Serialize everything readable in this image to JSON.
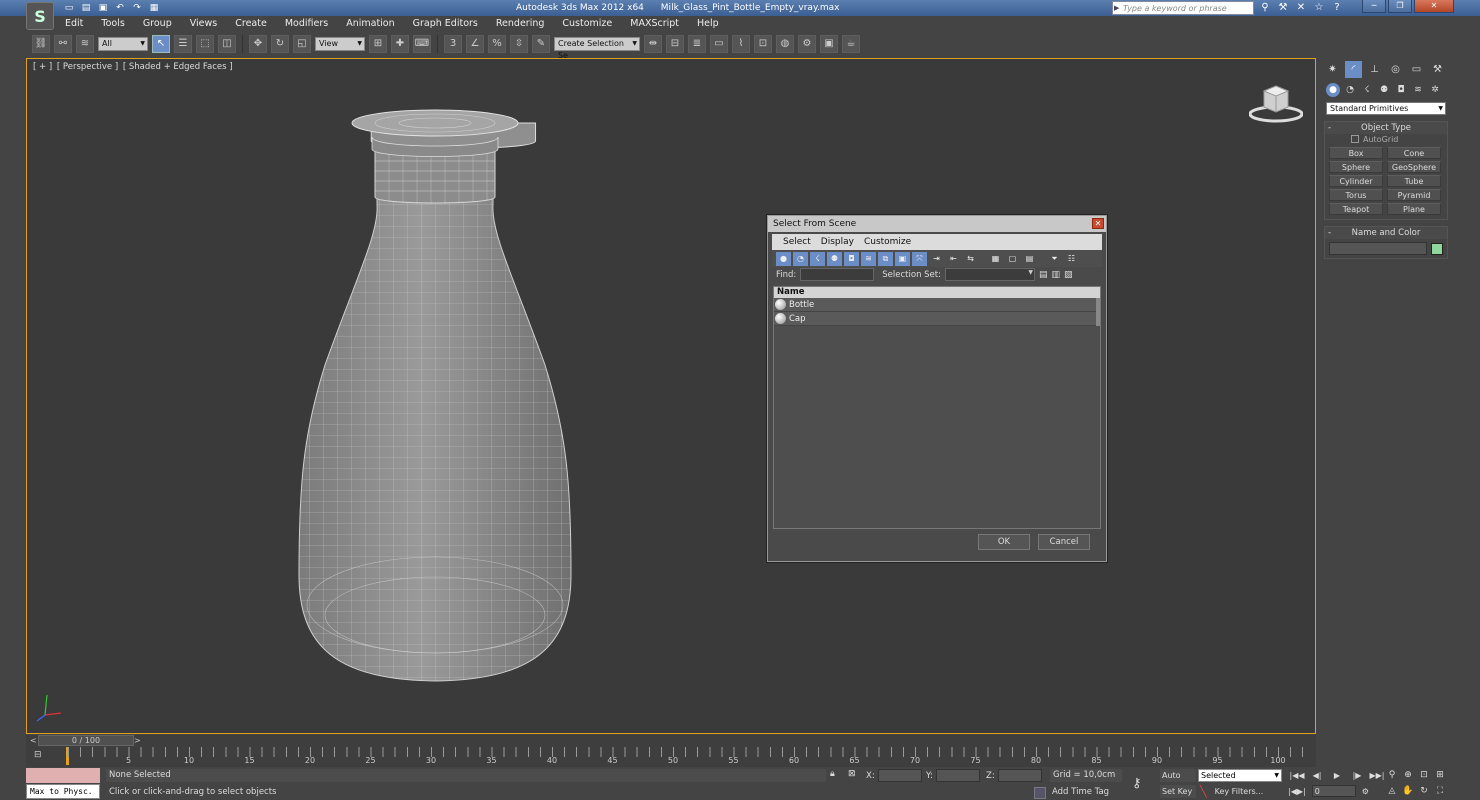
{
  "window": {
    "app_title": "Autodesk 3ds Max  2012 x64",
    "file_title": "Milk_Glass_Pint_Bottle_Empty_vray.max",
    "search_placeholder": "Type a keyword or phrase"
  },
  "menu": [
    "Edit",
    "Tools",
    "Group",
    "Views",
    "Create",
    "Modifiers",
    "Animation",
    "Graph Editors",
    "Rendering",
    "Customize",
    "MAXScript",
    "Help"
  ],
  "toolbar": {
    "selection_filter": "All",
    "ref_coord": "View",
    "named_selection_placeholder": "Create Selection Se"
  },
  "viewport": {
    "label_plus": "[ + ]",
    "label_view": "[ Perspective ]",
    "label_shading": "[ Shaded + Edged Faces ]"
  },
  "command_panel": {
    "category": "Standard Primitives",
    "object_type_title": "Object Type",
    "autogrid": "AutoGrid",
    "primitives": [
      "Box",
      "Cone",
      "Sphere",
      "GeoSphere",
      "Cylinder",
      "Tube",
      "Torus",
      "Pyramid",
      "Teapot",
      "Plane"
    ],
    "name_color_title": "Name and Color",
    "object_color": "#8fd79c"
  },
  "timeline": {
    "frame_display": "0 / 100",
    "prev": "<",
    "next": ">",
    "tick_labels": [
      "5",
      "10",
      "15",
      "20",
      "25",
      "30",
      "35",
      "40",
      "45",
      "50",
      "55",
      "60",
      "65",
      "70",
      "75",
      "80",
      "85",
      "90",
      "95",
      "100"
    ]
  },
  "status": {
    "maxscript_label": "Max to Physc.",
    "selection": "None Selected",
    "prompt": "Click or click-and-drag to select objects",
    "x_label": "X:",
    "y_label": "Y:",
    "z_label": "Z:",
    "grid": "Grid = 10,0cm",
    "add_time_tag": "Add Time Tag",
    "auto_key": "Auto Key",
    "set_key": "Set Key",
    "key_mode": "Selected",
    "key_filters": "Key Filters...",
    "current_frame": "0"
  },
  "dialog": {
    "title": "Select From Scene",
    "menu": [
      "Select",
      "Display",
      "Customize"
    ],
    "find_label": "Find:",
    "selection_set_label": "Selection Set:",
    "column_name": "Name",
    "objects": [
      "Bottle",
      "Cap"
    ],
    "ok": "OK",
    "cancel": "Cancel"
  }
}
